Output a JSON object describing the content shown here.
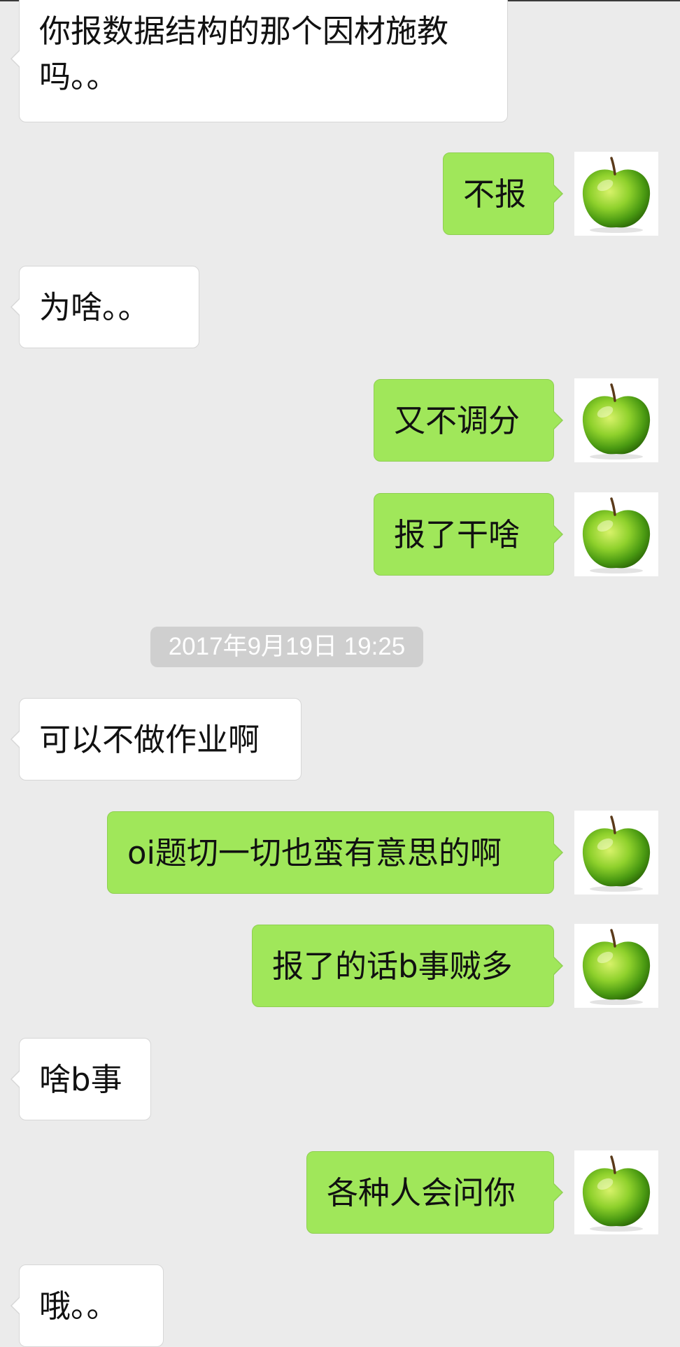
{
  "timestamp": "2017年9月19日 19:25",
  "messages": [
    {
      "side": "in",
      "text_line1": "你报数据结构的那个因材施教",
      "text_line2": "吗。。"
    },
    {
      "side": "out",
      "text": "不报",
      "avatar": "green-apple-icon"
    },
    {
      "side": "in",
      "text": "为啥。。"
    },
    {
      "side": "out",
      "text": "又不调分",
      "avatar": "green-apple-icon"
    },
    {
      "side": "out",
      "text": "报了干啥",
      "avatar": "green-apple-icon"
    },
    {
      "side": "in",
      "text": "可以不做作业啊"
    },
    {
      "side": "out",
      "text": "oi题切一切也蛮有意思的啊",
      "avatar": "green-apple-icon"
    },
    {
      "side": "out",
      "text": "报了的话b事贼多",
      "avatar": "green-apple-icon"
    },
    {
      "side": "in",
      "text": "啥b事"
    },
    {
      "side": "out",
      "text": "各种人会问你",
      "avatar": "green-apple-icon"
    },
    {
      "side": "in",
      "text": "哦。。"
    }
  ],
  "colors": {
    "background": "#ebebeb",
    "incoming_bubble": "#ffffff",
    "outgoing_bubble": "#a0e75a",
    "timestamp_pill": "#cfcfcf"
  }
}
